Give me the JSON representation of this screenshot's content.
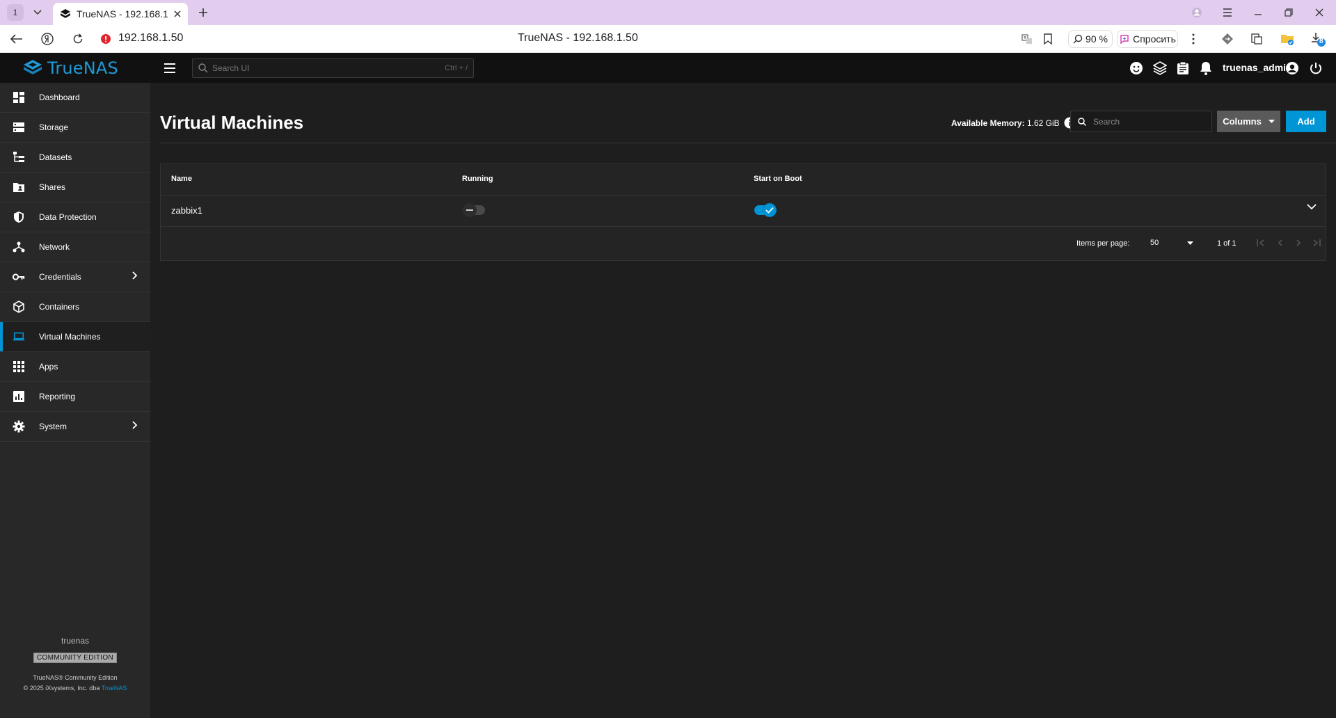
{
  "browser": {
    "tab_count": "1",
    "tab_title": "TrueNAS - 192.168.1.50",
    "url": "192.168.1.50",
    "page_title": "TrueNAS - 192.168.1.50",
    "zoom": "90 %",
    "ask_label": "Спросить",
    "downloads_badge": "8"
  },
  "header": {
    "logo_text": "TrueNAS",
    "search_placeholder": "Search UI",
    "search_shortcut": "Ctrl + /",
    "username": "truenas_admin"
  },
  "sidebar": {
    "items": [
      {
        "label": "Dashboard",
        "icon": "dashboard-icon"
      },
      {
        "label": "Storage",
        "icon": "storage-icon"
      },
      {
        "label": "Datasets",
        "icon": "datasets-icon"
      },
      {
        "label": "Shares",
        "icon": "shares-icon"
      },
      {
        "label": "Data Protection",
        "icon": "shield-icon"
      },
      {
        "label": "Network",
        "icon": "network-icon"
      },
      {
        "label": "Credentials",
        "icon": "key-icon"
      },
      {
        "label": "Containers",
        "icon": "cube-icon"
      },
      {
        "label": "Virtual Machines",
        "icon": "laptop-icon"
      },
      {
        "label": "Apps",
        "icon": "apps-grid-icon"
      },
      {
        "label": "Reporting",
        "icon": "chart-icon"
      },
      {
        "label": "System",
        "icon": "gear-icon"
      }
    ],
    "active": "Virtual Machines",
    "footer": {
      "hostname": "truenas",
      "edition_badge": "COMMUNITY EDITION",
      "product": "TrueNAS® Community Edition",
      "copyright_prefix": "© 2025 iXsystems, Inc. dba ",
      "copyright_link": "TrueNAS"
    }
  },
  "main": {
    "title": "Virtual Machines",
    "available_memory_label": "Available Memory:",
    "available_memory_value": "1.62 GiB",
    "search_placeholder": "Search",
    "columns_label": "Columns",
    "add_label": "Add",
    "table": {
      "headers": [
        "Name",
        "Running",
        "Start on Boot"
      ],
      "rows": [
        {
          "name": "zabbix1",
          "running": false,
          "start_on_boot": true
        }
      ]
    },
    "pagination": {
      "items_per_page_label": "Items per page:",
      "items_per_page": "50",
      "range": "1 of 1"
    }
  },
  "colors": {
    "accent": "#0095d5",
    "sidebar_bg": "#282828",
    "main_bg": "#1e1e1e",
    "header_bg": "#111111",
    "browser_tab_strip": "#e3cdee"
  }
}
